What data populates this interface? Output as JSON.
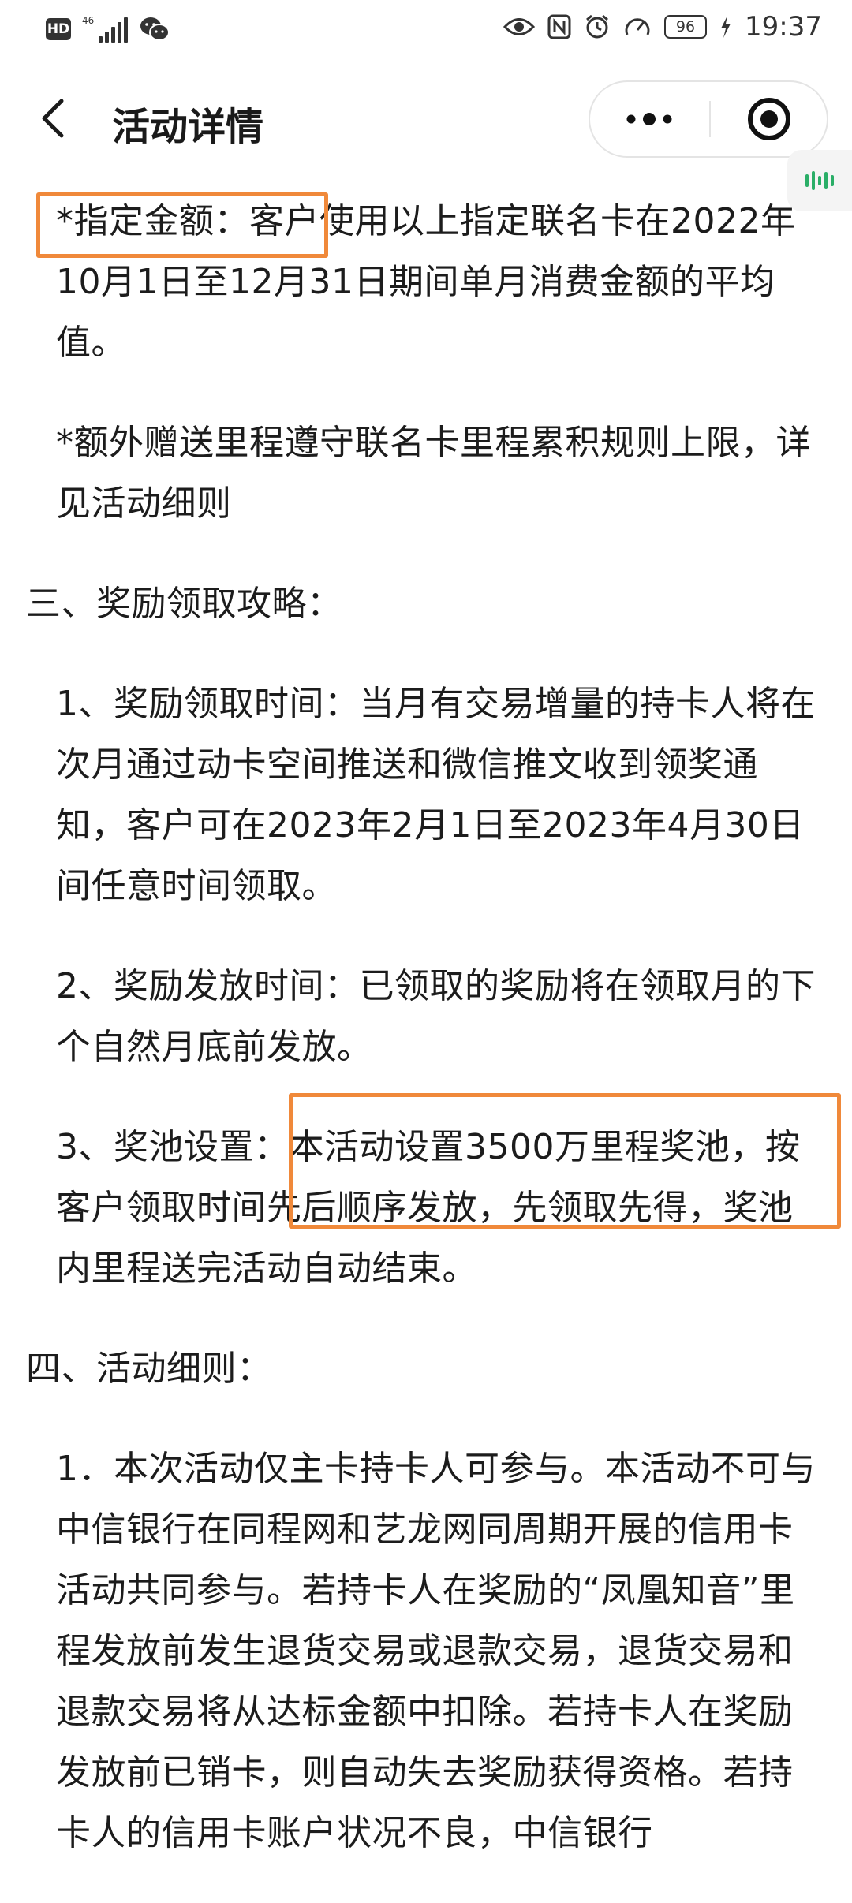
{
  "status_bar": {
    "hd_label": "HD",
    "network_label": "46",
    "battery_level": "96",
    "time": "19:37"
  },
  "nav": {
    "title": "活动详情"
  },
  "icons": {
    "back": "chevron-left-icon",
    "more": "more-dots-icon",
    "close": "target-close-icon",
    "audio": "audio-wave-icon",
    "wechat": "wechat-icon",
    "eye": "eye-icon",
    "nfc": "nfc-icon",
    "alarm": "alarm-icon",
    "speed": "speedometer-icon",
    "charging": "charging-bolt-icon"
  },
  "colors": {
    "highlight": "#f0893a",
    "text": "#1c1c1c"
  },
  "article": {
    "paragraphs": [
      "*指定金额：客户使用以上指定联名卡在2022年10月1日至12月31日期间单月消费金额的平均值。",
      "*额外赠送里程遵守联名卡里程累积规则上限，详见活动细则",
      "三、奖励领取攻略：",
      "1、奖励领取时间：当月有交易增量的持卡人将在次月通过动卡空间推送和微信推文收到领奖通知，客户可在2023年2月1日至2023年4月30日间任意时间领取。",
      "2、奖励发放时间：已领取的奖励将在领取月的下个自然月底前发放。",
      "3、奖池设置：本活动设置3500万里程奖池，按客户领取时间先后顺序发放，先领取先得，奖池内里程送完活动自动结束。",
      "四、活动细则：",
      "1．本次活动仅主卡持卡人可参与。本活动不可与中信银行在同程网和艺龙网同周期开展的信用卡活动共同参与。若持卡人在奖励的“凤凰知音”里程发放前发生退货交易或退款交易，退货交易和退款交易将从达标金额中扣除。若持卡人在奖励发放前已销卡，则自动失去奖励获得资格。若持卡人的信用卡账户状况不良，中信银行"
    ]
  }
}
